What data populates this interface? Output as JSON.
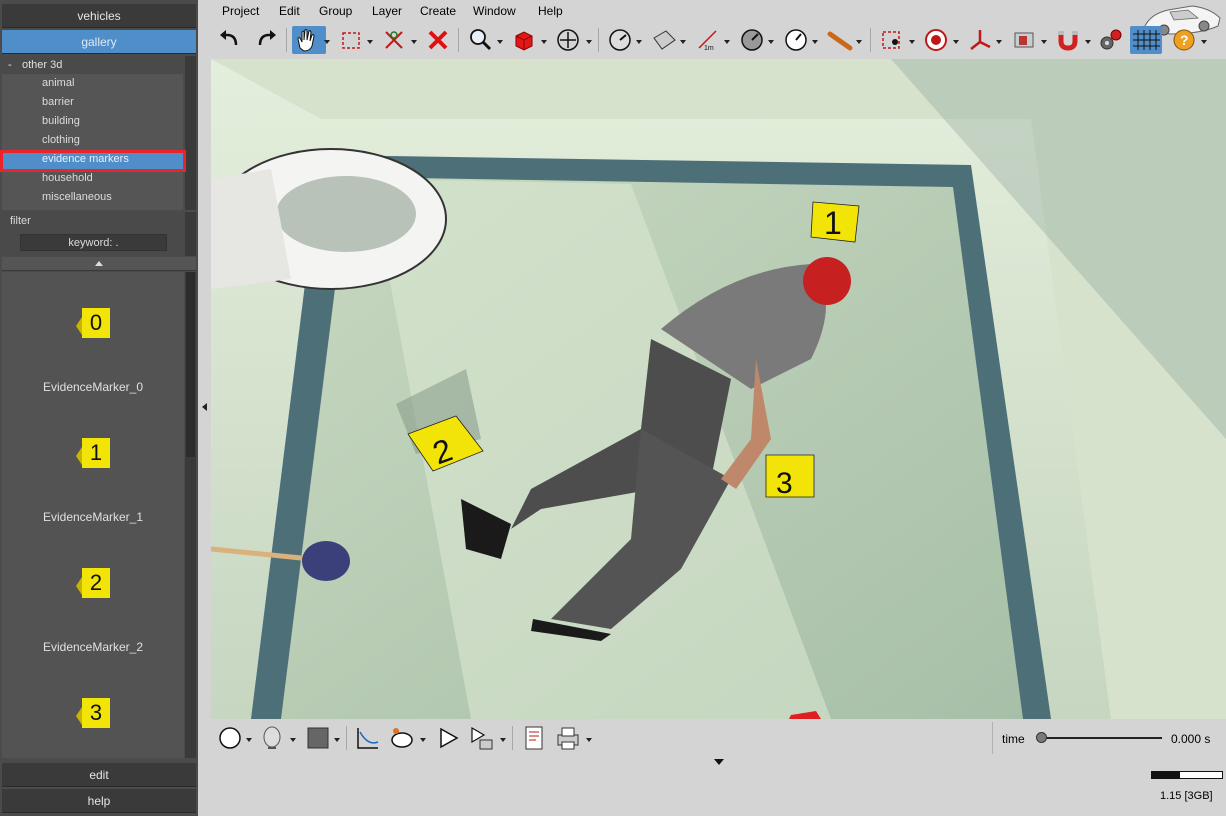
{
  "left_panel": {
    "vehicles_tab": "vehicles",
    "gallery_tab": "gallery",
    "tree": {
      "root_toggle": "-",
      "root_label": "other 3d",
      "items": [
        {
          "label": "animal"
        },
        {
          "label": "barrier"
        },
        {
          "label": "building"
        },
        {
          "label": "clothing"
        },
        {
          "label": "evidence markers",
          "selected": true
        },
        {
          "label": "household"
        },
        {
          "label": "miscellaneous"
        }
      ]
    },
    "filter_label": "filter",
    "keyword_placeholder": "keyword: .",
    "gallery_items": [
      {
        "marker": "0",
        "name": "EvidenceMarker_0"
      },
      {
        "marker": "1",
        "name": "EvidenceMarker_1"
      },
      {
        "marker": "2",
        "name": "EvidenceMarker_2"
      },
      {
        "marker": "3",
        "name": ""
      }
    ],
    "edit_tab": "edit",
    "help_tab": "help"
  },
  "menu": [
    "Project",
    "Edit",
    "Group",
    "Layer",
    "Create",
    "Window",
    "Help"
  ],
  "toolbar_icons": [
    "undo-icon",
    "redo-icon",
    "pan-hand-icon",
    "select-rectangle-icon",
    "cut-icon",
    "delete-icon",
    "zoom-icon",
    "box-3d-icon",
    "move-icon",
    "measure-angle-icon",
    "surface-icon",
    "measure-distance-icon",
    "gauge-icon",
    "circle-measure-icon",
    "pipe-icon",
    "record-icon",
    "target-icon",
    "axis-icon",
    "texture-icon",
    "magnet-icon",
    "settings-icon",
    "grid-icon",
    "help-icon"
  ],
  "scene": {
    "markers": [
      "1",
      "2",
      "3"
    ]
  },
  "bottom": {
    "icons": [
      "circle-icon",
      "head-icon",
      "color-square-icon",
      "curve-icon",
      "camera-icon",
      "play-icon",
      "sequence-icon",
      "report-icon",
      "print-icon"
    ],
    "time_label": "time",
    "time_value": "0.000 s",
    "time_position": 0,
    "memory_label": "1.15 [3GB]",
    "memory_fraction": 0.4
  },
  "colors": {
    "accent": "#4f8ec9",
    "highlight": "#e8242c",
    "marker_yellow": "#f3e407"
  }
}
